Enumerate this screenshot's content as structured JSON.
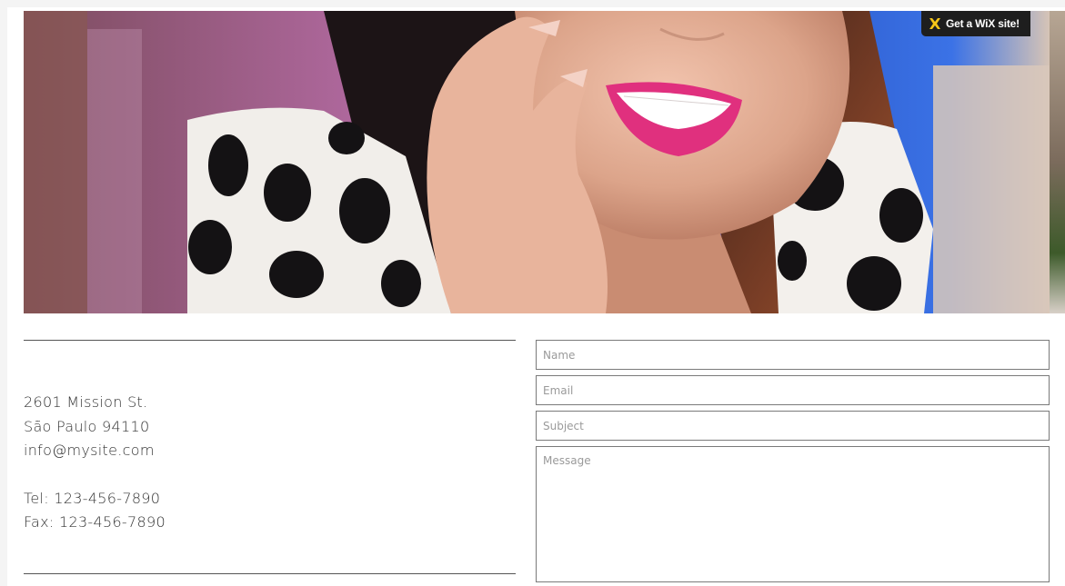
{
  "badge": {
    "label": "Get a WiX site!",
    "icon": "wix-logo-icon"
  },
  "hero": {
    "icon": "hero-photo-smiling-woman"
  },
  "contact": {
    "address_line1": "2601 Mission St.",
    "address_line2": "São Paulo 94110",
    "email": "info@mysite.com",
    "tel": "Tel: 123-456-7890",
    "fax": "Fax: 123-456-7890"
  },
  "form": {
    "name_placeholder": "Name",
    "email_placeholder": "Email",
    "subject_placeholder": "Subject",
    "message_placeholder": "Message"
  },
  "colors": {
    "badge_bg": "#1e1e1e",
    "lipstick": "#e0307e",
    "polka": "#111111",
    "field_border": "#7a7a7a"
  }
}
